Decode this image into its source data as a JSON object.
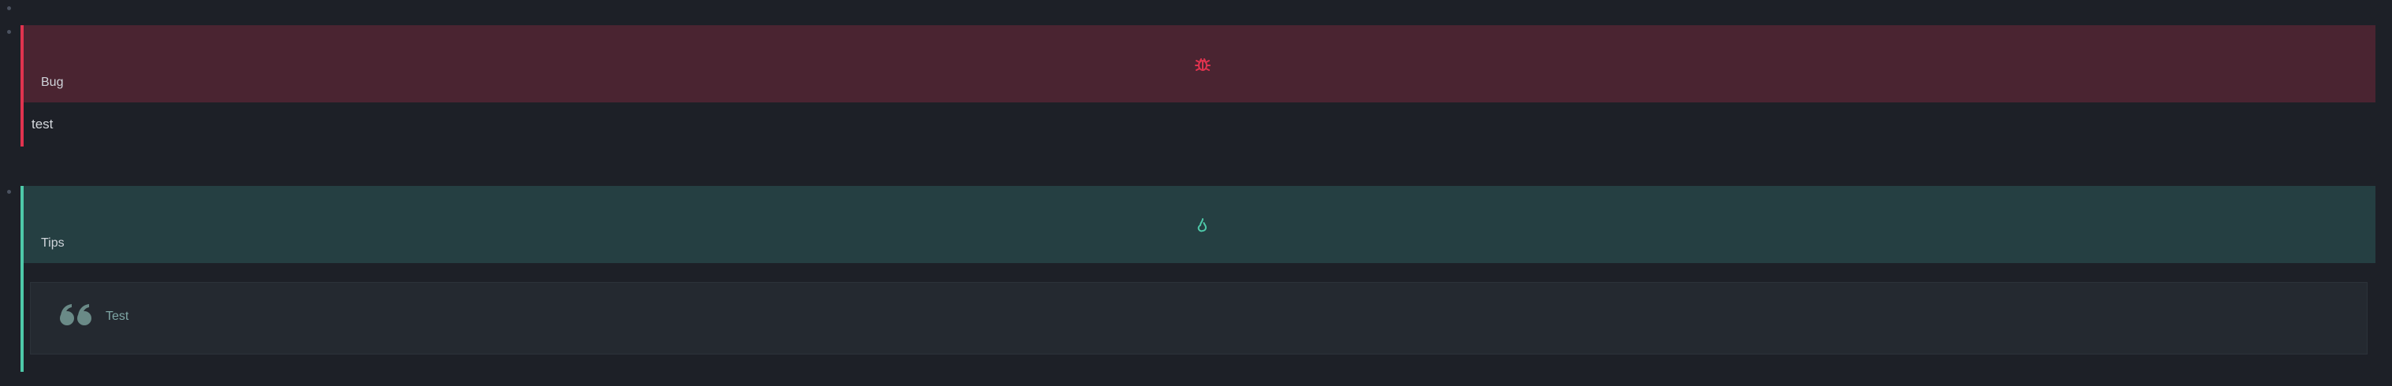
{
  "callouts": [
    {
      "type": "bug",
      "title": "Bug",
      "content": "test",
      "icon": "bug-icon",
      "accent": "#e0334f",
      "header_bg": "#4a2431"
    },
    {
      "type": "tips",
      "title": "Tips",
      "icon": "flame-icon",
      "accent": "#4ec9a9",
      "header_bg": "#253f42",
      "quote": {
        "icon": "quote-icon",
        "text": "Test"
      }
    }
  ]
}
